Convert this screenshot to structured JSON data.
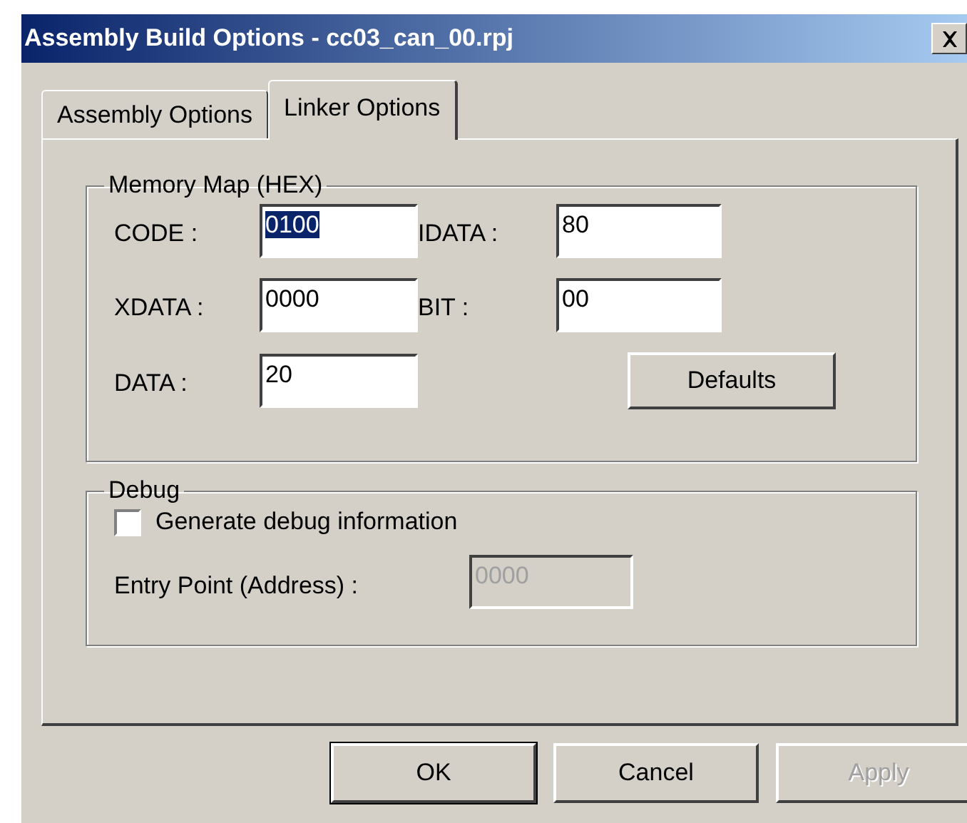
{
  "window": {
    "title": "Assembly Build Options - cc03_can_00.rpj"
  },
  "tabs": [
    {
      "label": "Assembly Options",
      "selected": false
    },
    {
      "label": "Linker Options",
      "selected": true
    }
  ],
  "memory_map": {
    "title": "Memory Map (HEX)",
    "fields": [
      {
        "label": "CODE :",
        "value": "0100",
        "selected": true
      },
      {
        "label": "IDATA :",
        "value": "80",
        "selected": false
      },
      {
        "label": "XDATA :",
        "value": "0000",
        "selected": false
      },
      {
        "label": "BIT :",
        "value": "00",
        "selected": false
      },
      {
        "label": "DATA :",
        "value": "20",
        "selected": false
      }
    ],
    "defaults_button": "Defaults"
  },
  "debug": {
    "title": "Debug",
    "checkbox": {
      "label": "Generate debug information",
      "checked": false
    },
    "entry_point": {
      "label": "Entry Point (Address) :",
      "value": "0000",
      "disabled": true
    }
  },
  "buttons": [
    {
      "label": "OK",
      "default": true,
      "disabled": false
    },
    {
      "label": "Cancel",
      "default": false,
      "disabled": false
    },
    {
      "label": "Apply",
      "default": false,
      "disabled": true
    }
  ]
}
